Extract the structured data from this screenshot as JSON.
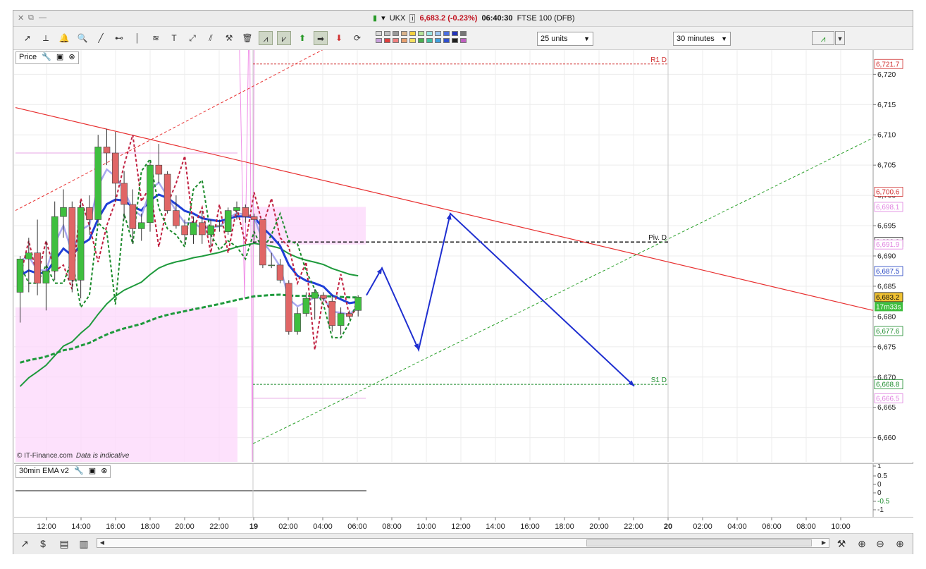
{
  "window": {
    "controls": [
      "✕",
      "⧉",
      "—"
    ],
    "instrument": "UKX",
    "price_change": "6,683.2 (-0.23%)",
    "time": "06:40:30",
    "market": "FTSE 100 (DFB)"
  },
  "toolbar": {
    "units": "25 units",
    "interval": "30 minutes",
    "tool_icons": [
      "cursor-icon",
      "ruler-icon",
      "alarm-bell-icon",
      "zoom-icon",
      "trend-line-icon",
      "horizontal-line-icon",
      "vertical-line-icon",
      "fibonacci-icon",
      "text-icon",
      "channel-icon",
      "parallel-icon",
      "tools-icon",
      "trash-icon",
      "chart-style-1-icon",
      "chart-style-2-icon",
      "buy-arrow-icon",
      "right-arrow-icon",
      "sell-arrow-icon",
      "loop-icon"
    ],
    "swatch_colors": [
      "#d8d8d8",
      "#bfbfbf",
      "#9a9a9a",
      "#d9b38c",
      "#f4d03f",
      "#b7e39a",
      "#9be3e3",
      "#9ec7f0",
      "#4a6ee0",
      "#2233bb",
      "#777777",
      "#c9a0dc",
      "#e04040",
      "#f08080",
      "#e8a070",
      "#f5e060",
      "#4caf50",
      "#40c0a0",
      "#40a0e0",
      "#3050d0",
      "#202020",
      "#c060c0"
    ]
  },
  "price_panel": {
    "label": "Price"
  },
  "osc_panel": {
    "label": "30min EMA v2"
  },
  "copyright": {
    "text": "© IT-Finance.com",
    "note": "Data is indicative"
  },
  "chart_data": {
    "type": "candlestick",
    "instrument": "UKX",
    "interval": "30 minutes",
    "ylim": [
      6656,
      6724
    ],
    "x_ticks": [
      "12:00",
      "14:00",
      "16:00",
      "18:00",
      "20:00",
      "22:00",
      "19",
      "02:00",
      "04:00",
      "06:00",
      "08:00",
      "10:00",
      "12:00",
      "14:00",
      "16:00",
      "18:00",
      "20:00",
      "22:00",
      "20",
      "02:00",
      "04:00",
      "06:00",
      "08:00",
      "10:00"
    ],
    "y_ticks": [
      "6,720",
      "6,715",
      "6,710",
      "6,705",
      "6,700",
      "6,695",
      "6,690",
      "6,685",
      "6,680",
      "6,675",
      "6,670",
      "6,665",
      "6,660"
    ],
    "candles": [
      {
        "o": 6684.0,
        "h": 6690.0,
        "l": 6679.0,
        "c": 6689.5
      },
      {
        "o": 6689.5,
        "h": 6693.0,
        "l": 6684.0,
        "c": 6690.5
      },
      {
        "o": 6690.5,
        "h": 6696.0,
        "l": 6683.5,
        "c": 6685.5
      },
      {
        "o": 6685.5,
        "h": 6692.5,
        "l": 6681.0,
        "c": 6687.5
      },
      {
        "o": 6687.5,
        "h": 6699.0,
        "l": 6686.0,
        "c": 6696.5
      },
      {
        "o": 6696.5,
        "h": 6701.0,
        "l": 6693.0,
        "c": 6698.0
      },
      {
        "o": 6698.0,
        "h": 6699.0,
        "l": 6684.0,
        "c": 6686.0
      },
      {
        "o": 6686.0,
        "h": 6699.0,
        "l": 6683.0,
        "c": 6698.0
      },
      {
        "o": 6698.0,
        "h": 6700.0,
        "l": 6693.5,
        "c": 6696.0
      },
      {
        "o": 6696.0,
        "h": 6710.0,
        "l": 6695.5,
        "c": 6708.0
      },
      {
        "o": 6708.0,
        "h": 6711.0,
        "l": 6705.0,
        "c": 6707.0
      },
      {
        "o": 6707.0,
        "h": 6710.5,
        "l": 6699.0,
        "c": 6702.0
      },
      {
        "o": 6702.0,
        "h": 6704.0,
        "l": 6696.0,
        "c": 6698.5
      },
      {
        "o": 6698.5,
        "h": 6701.0,
        "l": 6692.0,
        "c": 6694.5
      },
      {
        "o": 6694.5,
        "h": 6697.0,
        "l": 6692.5,
        "c": 6695.5
      },
      {
        "o": 6695.5,
        "h": 6705.5,
        "l": 6694.0,
        "c": 6705.0
      },
      {
        "o": 6705.0,
        "h": 6708.5,
        "l": 6702.0,
        "c": 6703.5
      },
      {
        "o": 6703.5,
        "h": 6704.0,
        "l": 6697.0,
        "c": 6697.5
      },
      {
        "o": 6697.5,
        "h": 6700.0,
        "l": 6694.5,
        "c": 6695.0
      },
      {
        "o": 6695.0,
        "h": 6696.0,
        "l": 6692.0,
        "c": 6693.5
      },
      {
        "o": 6693.5,
        "h": 6696.5,
        "l": 6692.0,
        "c": 6695.5
      },
      {
        "o": 6695.5,
        "h": 6697.5,
        "l": 6692.0,
        "c": 6693.5
      },
      {
        "o": 6693.5,
        "h": 6696.0,
        "l": 6691.5,
        "c": 6695.0
      },
      {
        "o": 6695.0,
        "h": 6696.0,
        "l": 6694.0,
        "c": 6695.0
      },
      {
        "o": 6694.0,
        "h": 6698.0,
        "l": 6693.5,
        "c": 6697.5
      },
      {
        "o": 6697.5,
        "h": 6699.0,
        "l": 6696.0,
        "c": 6698.0
      },
      {
        "o": 6698.0,
        "h": 6698.5,
        "l": 6695.5,
        "c": 6696.5
      },
      {
        "o": 6696.5,
        "h": 6697.0,
        "l": 6692.5,
        "c": 6696.0
      },
      {
        "o": 6696.0,
        "h": 6696.0,
        "l": 6688.0,
        "c": 6688.5
      },
      {
        "o": 6688.5,
        "h": 6690.5,
        "l": 6688.0,
        "c": 6688.5
      },
      {
        "o": 6688.5,
        "h": 6689.5,
        "l": 6685.5,
        "c": 6686.0
      },
      {
        "o": 6685.5,
        "h": 6686.0,
        "l": 6677.0,
        "c": 6677.5
      },
      {
        "o": 6677.5,
        "h": 6681.5,
        "l": 6677.0,
        "c": 6680.5
      },
      {
        "o": 6680.5,
        "h": 6684.0,
        "l": 6680.0,
        "c": 6683.0
      },
      {
        "o": 6683.0,
        "h": 6684.5,
        "l": 6679.5,
        "c": 6684.0
      },
      {
        "o": 6683.5,
        "h": 6684.0,
        "l": 6682.5,
        "c": 6683.0
      },
      {
        "o": 6682.5,
        "h": 6683.5,
        "l": 6677.5,
        "c": 6678.5
      },
      {
        "o": 6678.5,
        "h": 6681.5,
        "l": 6677.0,
        "c": 6680.5
      },
      {
        "o": 6680.5,
        "h": 6681.0,
        "l": 6679.5,
        "c": 6680.0
      },
      {
        "o": 6681.0,
        "h": 6683.5,
        "l": 6680.0,
        "c": 6683.2
      }
    ],
    "price_labels": [
      {
        "value": 6721.7,
        "text": "6,721.7",
        "color": "#d03030",
        "fill": "#ffffff"
      },
      {
        "value": 6700.6,
        "text": "6,700.6",
        "color": "#d03030",
        "fill": "#ffffff"
      },
      {
        "value": 6698.1,
        "text": "6,698.1",
        "color": "#e080e0",
        "fill": "#ffffff"
      },
      {
        "value": 6692.3,
        "text": "6,692.3",
        "color": "#111111",
        "fill": "#ffffff"
      },
      {
        "value": 6691.9,
        "text": "6,691.9",
        "color": "#e080e0",
        "fill": "#ffffff"
      },
      {
        "value": 6687.5,
        "text": "6,687.5",
        "color": "#2040c0",
        "fill": "#ffffff"
      },
      {
        "value": 6683.2,
        "text": "6,683.2",
        "color": "#111111",
        "fill": "#f1c232"
      },
      {
        "value": 6677.6,
        "text": "6,677.6",
        "color": "#1a8a2a",
        "fill": "#ffffff"
      },
      {
        "value": 6668.8,
        "text": "6,668.8",
        "color": "#1a8a2a",
        "fill": "#ffffff"
      },
      {
        "value": 6666.5,
        "text": "6,666.5",
        "color": "#e080e0",
        "fill": "#ffffff"
      }
    ],
    "countdown": "17m33s",
    "levels": [
      {
        "name": "R1 D",
        "value": 6721.7,
        "color": "#d03030"
      },
      {
        "name": "Piv. D",
        "value": 6692.3,
        "color": "#111111"
      },
      {
        "name": "S1 D",
        "value": 6668.8,
        "color": "#1a8a2a"
      }
    ],
    "osc_ticks": [
      "1",
      "0.5",
      "0",
      "0",
      "-0.5",
      "-1"
    ],
    "forecast_path": [
      6683.5,
      6688.0,
      6674.5,
      6697.0,
      6668.5
    ],
    "colors": {
      "up": "#3fbf3f",
      "down": "#e06666",
      "ema_fast": "#a9a9f0",
      "ema_mid": "#1f3fd8",
      "ema_slow": "#1e9a3c",
      "trend": "#e83030",
      "forecast": "#1f2fd0",
      "box": "#fdd9fb"
    }
  }
}
